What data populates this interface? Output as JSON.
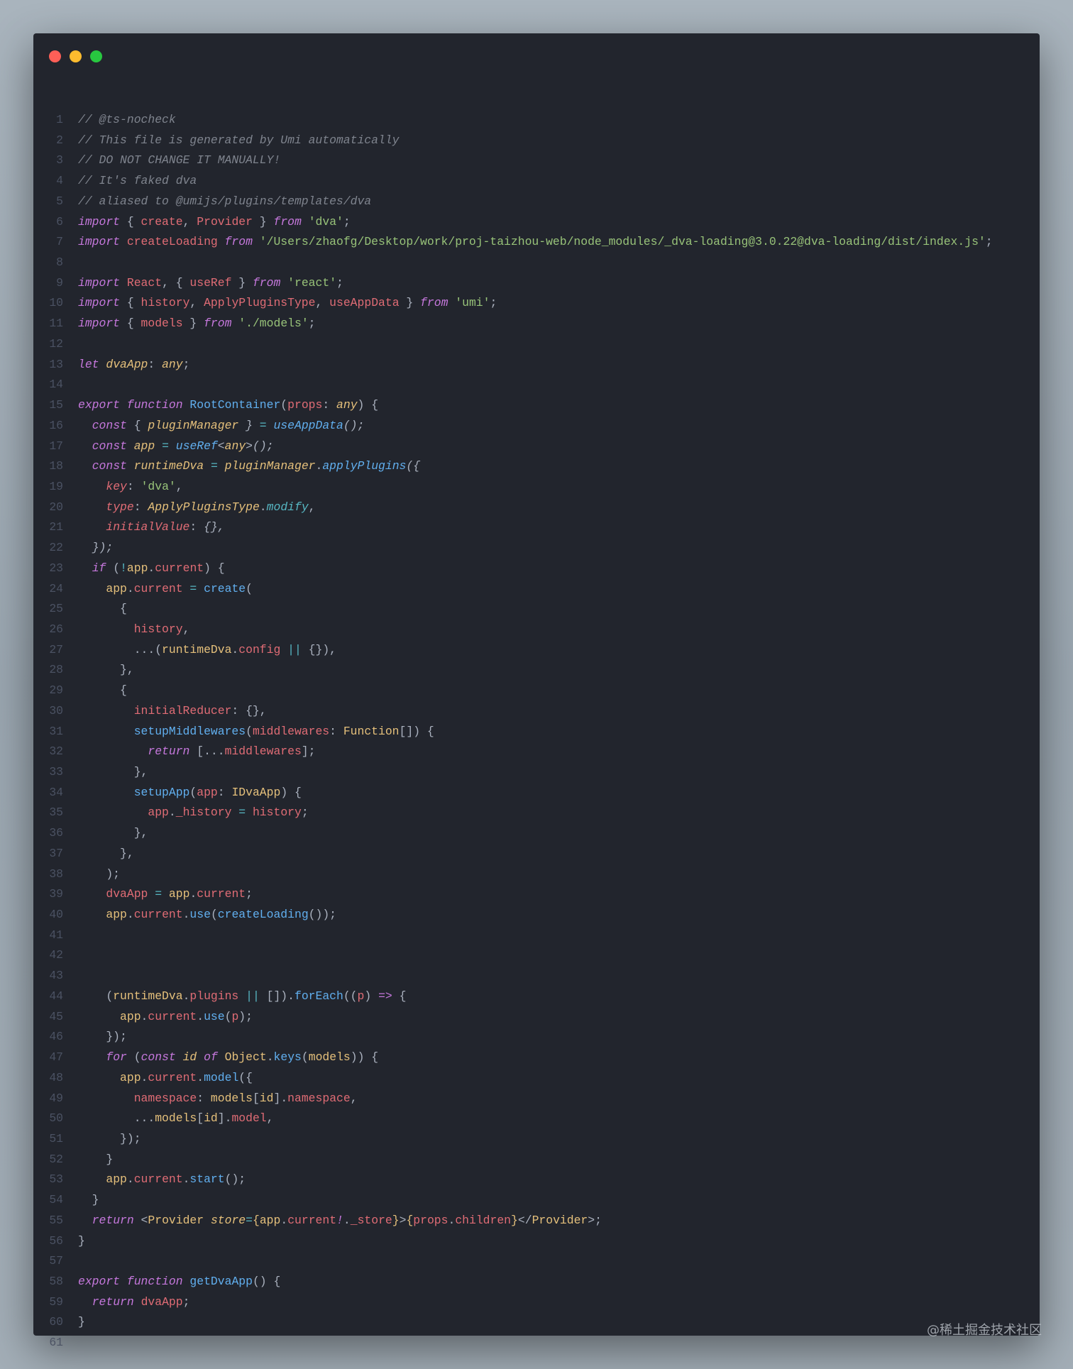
{
  "window": {
    "controls": {
      "close_color": "#ff5f57",
      "minimize_color": "#febc2e",
      "zoom_color": "#28c840"
    }
  },
  "watermark": "@稀土掘金技术社区",
  "code": {
    "lines": [
      [
        [
          "c",
          "// @ts-nocheck"
        ]
      ],
      [
        [
          "c",
          "// This file is generated by Umi automatically"
        ]
      ],
      [
        [
          "c",
          "// DO NOT CHANGE IT MANUALLY!"
        ]
      ],
      [
        [
          "c",
          "// It's faked dva"
        ]
      ],
      [
        [
          "c",
          "// aliased to @umijs/plugins/templates/dva"
        ]
      ],
      [
        [
          "k",
          "import"
        ],
        [
          "p",
          " { "
        ],
        [
          "v",
          "create"
        ],
        [
          "p",
          ", "
        ],
        [
          "v",
          "Provider"
        ],
        [
          "p",
          " } "
        ],
        [
          "k",
          "from"
        ],
        [
          "p",
          " "
        ],
        [
          "s",
          "'dva'"
        ],
        [
          "p",
          ";"
        ]
      ],
      [
        [
          "k",
          "import"
        ],
        [
          "p",
          " "
        ],
        [
          "v",
          "createLoading"
        ],
        [
          "p",
          " "
        ],
        [
          "k",
          "from"
        ],
        [
          "p",
          " "
        ],
        [
          "s",
          "'/Users/zhaofg/Desktop/work/proj-taizhou-web/node_modules/_dva-loading@3.0.22@dva-loading/dist/index.js'"
        ],
        [
          "p",
          ";"
        ]
      ],
      [],
      [
        [
          "k",
          "import"
        ],
        [
          "p",
          " "
        ],
        [
          "v",
          "React"
        ],
        [
          "p",
          ", { "
        ],
        [
          "v",
          "useRef"
        ],
        [
          "p",
          " } "
        ],
        [
          "k",
          "from"
        ],
        [
          "p",
          " "
        ],
        [
          "s",
          "'react'"
        ],
        [
          "p",
          ";"
        ]
      ],
      [
        [
          "k",
          "import"
        ],
        [
          "p",
          " { "
        ],
        [
          "v",
          "history"
        ],
        [
          "p",
          ", "
        ],
        [
          "v",
          "ApplyPluginsType"
        ],
        [
          "p",
          ", "
        ],
        [
          "v",
          "useAppData"
        ],
        [
          "p",
          " } "
        ],
        [
          "k",
          "from"
        ],
        [
          "p",
          " "
        ],
        [
          "s",
          "'umi'"
        ],
        [
          "p",
          ";"
        ]
      ],
      [
        [
          "k",
          "import"
        ],
        [
          "p",
          " { "
        ],
        [
          "v",
          "models"
        ],
        [
          "p",
          " } "
        ],
        [
          "k",
          "from"
        ],
        [
          "p",
          " "
        ],
        [
          "s",
          "'./models'"
        ],
        [
          "p",
          ";"
        ]
      ],
      [],
      [
        [
          "k",
          "let"
        ],
        [
          "p",
          " "
        ],
        [
          "yi",
          "dvaApp"
        ],
        [
          "p",
          ": "
        ],
        [
          "yi",
          "any"
        ],
        [
          "p",
          ";"
        ]
      ],
      [],
      [
        [
          "k",
          "export"
        ],
        [
          "p",
          " "
        ],
        [
          "k",
          "function"
        ],
        [
          "p",
          " "
        ],
        [
          "f",
          "RootContainer"
        ],
        [
          "p",
          "("
        ],
        [
          "v",
          "props"
        ],
        [
          "p",
          ": "
        ],
        [
          "yi",
          "any"
        ],
        [
          "p",
          ") {"
        ]
      ],
      [
        [
          "p",
          "  "
        ],
        [
          "k",
          "const"
        ],
        [
          "p",
          " { "
        ],
        [
          "yi",
          "pluginManager"
        ],
        [
          "pi",
          " } "
        ],
        [
          "t",
          "="
        ],
        [
          "p",
          " "
        ],
        [
          "fi",
          "useAppData"
        ],
        [
          "pi",
          "();"
        ]
      ],
      [
        [
          "p",
          "  "
        ],
        [
          "k",
          "const"
        ],
        [
          "p",
          " "
        ],
        [
          "yi",
          "app"
        ],
        [
          "p",
          " "
        ],
        [
          "t",
          "="
        ],
        [
          "p",
          " "
        ],
        [
          "fi",
          "useRef"
        ],
        [
          "p",
          "<"
        ],
        [
          "yi",
          "any"
        ],
        [
          "p",
          ">"
        ],
        [
          "pi",
          "();"
        ]
      ],
      [
        [
          "p",
          "  "
        ],
        [
          "k",
          "const"
        ],
        [
          "p",
          " "
        ],
        [
          "yi",
          "runtimeDva"
        ],
        [
          "p",
          " "
        ],
        [
          "t",
          "="
        ],
        [
          "p",
          " "
        ],
        [
          "yi",
          "pluginManager"
        ],
        [
          "p",
          "."
        ],
        [
          "fi",
          "applyPlugins"
        ],
        [
          "pi",
          "({"
        ]
      ],
      [
        [
          "p",
          "    "
        ],
        [
          "vi",
          "key"
        ],
        [
          "p",
          ": "
        ],
        [
          "s",
          "'dva'"
        ],
        [
          "p",
          ","
        ]
      ],
      [
        [
          "p",
          "    "
        ],
        [
          "vi",
          "type"
        ],
        [
          "p",
          ": "
        ],
        [
          "yi",
          "ApplyPluginsType"
        ],
        [
          "p",
          "."
        ],
        [
          "ti",
          "modify"
        ],
        [
          "p",
          ","
        ]
      ],
      [
        [
          "p",
          "    "
        ],
        [
          "vi",
          "initialValue"
        ],
        [
          "p",
          ": "
        ],
        [
          "pi",
          "{},"
        ]
      ],
      [
        [
          "p",
          "  "
        ],
        [
          "pi",
          "});"
        ]
      ],
      [
        [
          "p",
          "  "
        ],
        [
          "k",
          "if"
        ],
        [
          "p",
          " ("
        ],
        [
          "t",
          "!"
        ],
        [
          "y",
          "app"
        ],
        [
          "p",
          "."
        ],
        [
          "v",
          "current"
        ],
        [
          "p",
          ") {"
        ]
      ],
      [
        [
          "p",
          "    "
        ],
        [
          "y",
          "app"
        ],
        [
          "p",
          "."
        ],
        [
          "v",
          "current"
        ],
        [
          "p",
          " "
        ],
        [
          "t",
          "="
        ],
        [
          "p",
          " "
        ],
        [
          "f",
          "create"
        ],
        [
          "p",
          "("
        ]
      ],
      [
        [
          "p",
          "      {"
        ]
      ],
      [
        [
          "p",
          "        "
        ],
        [
          "v",
          "history"
        ],
        [
          "p",
          ","
        ]
      ],
      [
        [
          "p",
          "        ...("
        ],
        [
          "y",
          "runtimeDva"
        ],
        [
          "p",
          "."
        ],
        [
          "v",
          "config"
        ],
        [
          "p",
          " "
        ],
        [
          "t",
          "||"
        ],
        [
          "p",
          " {}),"
        ]
      ],
      [
        [
          "p",
          "      },"
        ]
      ],
      [
        [
          "p",
          "      {"
        ]
      ],
      [
        [
          "p",
          "        "
        ],
        [
          "v",
          "initialReducer"
        ],
        [
          "p",
          ": {},"
        ]
      ],
      [
        [
          "p",
          "        "
        ],
        [
          "f",
          "setupMiddlewares"
        ],
        [
          "p",
          "("
        ],
        [
          "v",
          "middlewares"
        ],
        [
          "p",
          ": "
        ],
        [
          "y",
          "Function"
        ],
        [
          "p",
          "[]) {"
        ]
      ],
      [
        [
          "p",
          "          "
        ],
        [
          "k",
          "return"
        ],
        [
          "p",
          " [..."
        ],
        [
          "v",
          "middlewares"
        ],
        [
          "p",
          "];"
        ]
      ],
      [
        [
          "p",
          "        },"
        ]
      ],
      [
        [
          "p",
          "        "
        ],
        [
          "f",
          "setupApp"
        ],
        [
          "p",
          "("
        ],
        [
          "v",
          "app"
        ],
        [
          "p",
          ": "
        ],
        [
          "y",
          "IDvaApp"
        ],
        [
          "p",
          ") {"
        ]
      ],
      [
        [
          "p",
          "          "
        ],
        [
          "v",
          "app"
        ],
        [
          "p",
          "."
        ],
        [
          "v",
          "_history"
        ],
        [
          "p",
          " "
        ],
        [
          "t",
          "="
        ],
        [
          "p",
          " "
        ],
        [
          "v",
          "history"
        ],
        [
          "p",
          ";"
        ]
      ],
      [
        [
          "p",
          "        },"
        ]
      ],
      [
        [
          "p",
          "      },"
        ]
      ],
      [
        [
          "p",
          "    );"
        ]
      ],
      [
        [
          "p",
          "    "
        ],
        [
          "v",
          "dvaApp"
        ],
        [
          "p",
          " "
        ],
        [
          "t",
          "="
        ],
        [
          "p",
          " "
        ],
        [
          "y",
          "app"
        ],
        [
          "p",
          "."
        ],
        [
          "v",
          "current"
        ],
        [
          "p",
          ";"
        ]
      ],
      [
        [
          "p",
          "    "
        ],
        [
          "y",
          "app"
        ],
        [
          "p",
          "."
        ],
        [
          "v",
          "current"
        ],
        [
          "p",
          "."
        ],
        [
          "f",
          "use"
        ],
        [
          "p",
          "("
        ],
        [
          "f",
          "createLoading"
        ],
        [
          "p",
          "());"
        ]
      ],
      [],
      [],
      [],
      [
        [
          "p",
          "    ("
        ],
        [
          "y",
          "runtimeDva"
        ],
        [
          "p",
          "."
        ],
        [
          "v",
          "plugins"
        ],
        [
          "p",
          " "
        ],
        [
          "t",
          "||"
        ],
        [
          "p",
          " [])."
        ],
        [
          "f",
          "forEach"
        ],
        [
          "p",
          "(("
        ],
        [
          "v",
          "p"
        ],
        [
          "p",
          ") "
        ],
        [
          "k",
          "=>"
        ],
        [
          "p",
          " {"
        ]
      ],
      [
        [
          "p",
          "      "
        ],
        [
          "y",
          "app"
        ],
        [
          "p",
          "."
        ],
        [
          "v",
          "current"
        ],
        [
          "p",
          "."
        ],
        [
          "f",
          "use"
        ],
        [
          "p",
          "("
        ],
        [
          "v",
          "p"
        ],
        [
          "p",
          ");"
        ]
      ],
      [
        [
          "p",
          "    });"
        ]
      ],
      [
        [
          "p",
          "    "
        ],
        [
          "k",
          "for"
        ],
        [
          "p",
          " ("
        ],
        [
          "k",
          "const"
        ],
        [
          "p",
          " "
        ],
        [
          "yi",
          "id"
        ],
        [
          "p",
          " "
        ],
        [
          "k",
          "of"
        ],
        [
          "p",
          " "
        ],
        [
          "y",
          "Object"
        ],
        [
          "p",
          "."
        ],
        [
          "f",
          "keys"
        ],
        [
          "p",
          "("
        ],
        [
          "y",
          "models"
        ],
        [
          "p",
          ")) {"
        ]
      ],
      [
        [
          "p",
          "      "
        ],
        [
          "y",
          "app"
        ],
        [
          "p",
          "."
        ],
        [
          "v",
          "current"
        ],
        [
          "p",
          "."
        ],
        [
          "f",
          "model"
        ],
        [
          "p",
          "({"
        ]
      ],
      [
        [
          "p",
          "        "
        ],
        [
          "v",
          "namespace"
        ],
        [
          "p",
          ": "
        ],
        [
          "y",
          "models"
        ],
        [
          "p",
          "["
        ],
        [
          "y",
          "id"
        ],
        [
          "p",
          "]."
        ],
        [
          "v",
          "namespace"
        ],
        [
          "p",
          ","
        ]
      ],
      [
        [
          "p",
          "        ..."
        ],
        [
          "y",
          "models"
        ],
        [
          "p",
          "["
        ],
        [
          "y",
          "id"
        ],
        [
          "p",
          "]."
        ],
        [
          "v",
          "model"
        ],
        [
          "p",
          ","
        ]
      ],
      [
        [
          "p",
          "      });"
        ]
      ],
      [
        [
          "p",
          "    }"
        ]
      ],
      [
        [
          "p",
          "    "
        ],
        [
          "y",
          "app"
        ],
        [
          "p",
          "."
        ],
        [
          "v",
          "current"
        ],
        [
          "p",
          "."
        ],
        [
          "f",
          "start"
        ],
        [
          "p",
          "();"
        ]
      ],
      [
        [
          "p",
          "  }"
        ]
      ],
      [
        [
          "p",
          "  "
        ],
        [
          "k",
          "return"
        ],
        [
          "p",
          " <"
        ],
        [
          "y",
          "Provider"
        ],
        [
          "p",
          " "
        ],
        [
          "yi",
          "store"
        ],
        [
          "t",
          "="
        ],
        [
          "y",
          "{"
        ],
        [
          "y",
          "app"
        ],
        [
          "p",
          "."
        ],
        [
          "v",
          "current"
        ],
        [
          "ki",
          "!"
        ],
        [
          "p",
          "."
        ],
        [
          "v",
          "_store"
        ],
        [
          "y",
          "}"
        ],
        [
          "p",
          ">"
        ],
        [
          "y",
          "{"
        ],
        [
          "v",
          "props"
        ],
        [
          "p",
          "."
        ],
        [
          "v",
          "children"
        ],
        [
          "y",
          "}"
        ],
        [
          "p",
          "</"
        ],
        [
          "y",
          "Provider"
        ],
        [
          "p",
          ">;"
        ]
      ],
      [
        [
          "p",
          "}"
        ]
      ],
      [],
      [
        [
          "k",
          "export"
        ],
        [
          "p",
          " "
        ],
        [
          "k",
          "function"
        ],
        [
          "p",
          " "
        ],
        [
          "f",
          "getDvaApp"
        ],
        [
          "p",
          "() {"
        ]
      ],
      [
        [
          "p",
          "  "
        ],
        [
          "k",
          "return"
        ],
        [
          "p",
          " "
        ],
        [
          "v",
          "dvaApp"
        ],
        [
          "p",
          ";"
        ]
      ],
      [
        [
          "p",
          "}"
        ]
      ],
      []
    ]
  }
}
